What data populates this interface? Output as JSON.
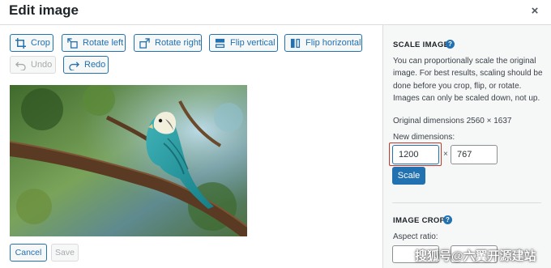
{
  "header": {
    "title": "Edit image",
    "close_symbol": "×"
  },
  "toolbar": {
    "crop": "Crop",
    "rotate_left": "Rotate left",
    "rotate_right": "Rotate right",
    "flip_vertical": "Flip vertical",
    "flip_horizontal": "Flip horizontal",
    "undo": "Undo",
    "redo": "Redo"
  },
  "sidebar": {
    "scale": {
      "title": "SCALE IMAGE",
      "description": "You can proportionally scale the original image. For best results, scaling should be done before you crop, flip, or rotate. Images can only be scaled down, not up.",
      "original_dimensions": "Original dimensions 2560 × 1637",
      "new_dimensions_label": "New dimensions:",
      "width_value": "1200",
      "height_value": "767",
      "times_symbol": "×",
      "scale_button": "Scale"
    },
    "crop": {
      "title": "IMAGE CROP",
      "aspect_ratio_label": "Aspect ratio:"
    },
    "help_symbol": "?"
  },
  "footer": {
    "cancel": "Cancel",
    "save": "Save"
  },
  "watermark": "搜狐号@六翼开源建站",
  "colors": {
    "accent": "#2271b1",
    "focus_highlight": "#c0392b",
    "sidebar_bg": "#f6f7f7"
  }
}
